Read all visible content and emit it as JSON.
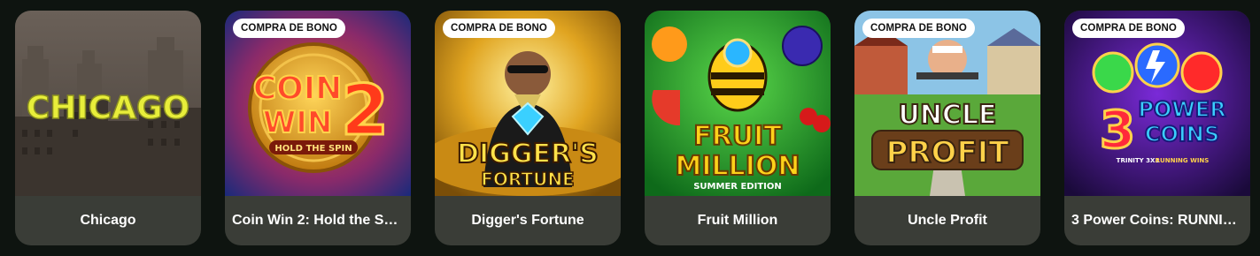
{
  "badge_label": "COMPRA DE BONO",
  "colors": {
    "page_bg": "#0e1410",
    "card_footer": "#3a3d37",
    "badge_bg": "#ffffff"
  },
  "games": [
    {
      "title": "Chicago",
      "has_badge": false,
      "logo": [
        "CHICAGO"
      ],
      "art": "chicago"
    },
    {
      "title": "Coin Win 2: Hold the Spin",
      "has_badge": true,
      "logo": [
        "COIN",
        "WIN",
        "2",
        "HOLD THE SPIN"
      ],
      "art": "coin-win"
    },
    {
      "title": "Digger's Fortune",
      "has_badge": true,
      "logo": [
        "DIGGER'S",
        "FORTUNE"
      ],
      "art": "digger"
    },
    {
      "title": "Fruit Million",
      "has_badge": false,
      "logo": [
        "FRUIT",
        "MILLION",
        "SUMMER EDITION"
      ],
      "art": "fruit"
    },
    {
      "title": "Uncle Profit",
      "has_badge": true,
      "logo": [
        "UNCLE",
        "PROFIT"
      ],
      "art": "uncle"
    },
    {
      "title": "3 Power Coins: RUNNIN...",
      "has_badge": true,
      "logo": [
        "3",
        "POWER",
        "COINS",
        "TRINITY 3X3",
        "RUNNING WINS"
      ],
      "art": "power"
    }
  ]
}
